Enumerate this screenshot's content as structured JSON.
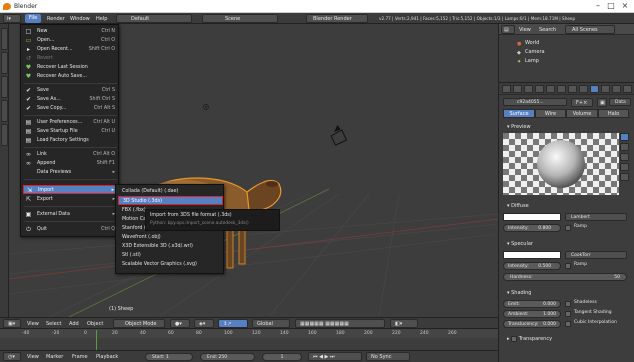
{
  "window": {
    "title": "Blender"
  },
  "topbar": {
    "menus": [
      "File",
      "Render",
      "Window",
      "Help"
    ],
    "screen_layout": "Default",
    "scene": "Scene",
    "render_engine": "Blender Render",
    "stats": "v2.77 | Verts:2,941 | Faces:5,152 | Tris:5,152 | Objects:1/3 | Lamps:0/1 | Mem:18.71M | Sheep"
  },
  "file_menu": {
    "items": [
      {
        "label": "New",
        "shortcut": "Ctrl N",
        "icon": "new-file-icon",
        "glyph": "□",
        "color": "#ddd"
      },
      {
        "label": "Open...",
        "shortcut": "Ctrl O",
        "icon": "open-folder-icon",
        "glyph": "▭",
        "color": "#d8b45a"
      },
      {
        "label": "Open Recent...",
        "shortcut": "Shift Ctrl O",
        "icon": "recent-icon",
        "glyph": "▸",
        "color": "#ddd"
      },
      {
        "label": "Revert",
        "shortcut": "",
        "icon": "revert-icon",
        "glyph": "↺",
        "color": "#777",
        "disabled": true
      },
      {
        "label": "Recover Last Session",
        "shortcut": "",
        "icon": "recover-icon",
        "glyph": "♥",
        "color": "#7fc36b"
      },
      {
        "label": "Recover Auto Save...",
        "shortcut": "",
        "icon": "recover-auto-icon",
        "glyph": "♥",
        "color": "#7fc36b"
      },
      {
        "label": "Save",
        "shortcut": "Ctrl S",
        "icon": "save-icon",
        "glyph": "✔",
        "color": "#ddd"
      },
      {
        "label": "Save As...",
        "shortcut": "Shift Ctrl S",
        "icon": "save-as-icon",
        "glyph": "✔",
        "color": "#ddd"
      },
      {
        "label": "Save Copy...",
        "shortcut": "Ctrl Alt S",
        "icon": "save-copy-icon",
        "glyph": "✔",
        "color": "#ddd"
      },
      {
        "label": "User Preferences...",
        "shortcut": "Ctrl Alt U",
        "icon": "preferences-icon",
        "glyph": "▤",
        "color": "#ddd"
      },
      {
        "label": "Save Startup File",
        "shortcut": "Ctrl U",
        "icon": "startup-icon",
        "glyph": "▤",
        "color": "#ddd"
      },
      {
        "label": "Load Factory Settings",
        "shortcut": "",
        "icon": "factory-icon",
        "glyph": "▤",
        "color": "#ddd"
      },
      {
        "label": "Link",
        "shortcut": "Ctrl Alt O",
        "icon": "link-icon",
        "glyph": "∞",
        "color": "#ddd"
      },
      {
        "label": "Append",
        "shortcut": "Shift F1",
        "icon": "append-icon",
        "glyph": "∞",
        "color": "#ddd"
      },
      {
        "label": "Data Previews",
        "shortcut": "▸",
        "icon": "",
        "glyph": "",
        "color": "#ddd"
      },
      {
        "label": "Import",
        "shortcut": "▸",
        "icon": "import-icon",
        "glyph": "⇲",
        "color": "#ddd",
        "highlight": true
      },
      {
        "label": "Export",
        "shortcut": "▸",
        "icon": "export-icon",
        "glyph": "⇱",
        "color": "#ddd"
      },
      {
        "label": "External Data",
        "shortcut": "▸",
        "icon": "external-icon",
        "glyph": "▣",
        "color": "#ddd"
      },
      {
        "label": "Quit",
        "shortcut": "Ctrl Q",
        "icon": "quit-icon",
        "glyph": "⏻",
        "color": "#ddd"
      }
    ]
  },
  "import_submenu": {
    "items": [
      {
        "label": "Collada (Default) (.dae)"
      },
      {
        "label": "3D Studio (.3ds)",
        "highlight": true
      },
      {
        "label": "FBX (.fbx)"
      },
      {
        "label": "Motion Capture (.bvh)"
      },
      {
        "label": "Stanford (.ply)"
      },
      {
        "label": "Wavefront (.obj)"
      },
      {
        "label": "X3D Extensible 3D (.x3d/.wrl)"
      },
      {
        "label": "Stl (.stl)"
      },
      {
        "label": "Scalable Vector Graphics (.svg)"
      }
    ]
  },
  "tooltip": {
    "title": "Import from 3DS file format (.3ds)",
    "python": "Python: bpy.ops.import_scene.autodesk_3ds()"
  },
  "viewport": {
    "object_label": "(1) Sheep"
  },
  "viewport_header": {
    "view": "View",
    "select": "Select",
    "add": "Add",
    "object": "Object",
    "mode": "Object Mode",
    "orientation": "Global"
  },
  "outliner": {
    "view": "View",
    "search": "Search",
    "scope": "All Scenes",
    "rows": [
      "World",
      "Camera",
      "Lamp"
    ]
  },
  "properties": {
    "material_name": "c92a4055...",
    "data_label": "Data",
    "tabs": [
      "Surface",
      "Wire",
      "Volume",
      "Halo"
    ],
    "preview_label": "Preview",
    "diffuse": {
      "label": "Diffuse",
      "shader": "Lambert",
      "intensity_label": "Intensity:",
      "intensity": "0.800",
      "ramp": "Ramp"
    },
    "specular": {
      "label": "Specular",
      "shader": "CookTorr",
      "intensity_label": "Intensity:",
      "intensity": "0.500",
      "ramp": "Ramp",
      "hardness_label": "Hardness:",
      "hardness": "50"
    },
    "shading": {
      "label": "Shading",
      "emit_label": "Emit:",
      "emit": "0.000",
      "ambient_label": "Ambient:",
      "ambient": "1.000",
      "translucency_label": "Translucency:",
      "translucency": "0.000",
      "shadeless": "Shadeless",
      "tangent": "Tangent Shading",
      "cubic": "Cubic Interpolation"
    },
    "transparency_label": "Transparency"
  },
  "timeline": {
    "ruler": [
      "-40",
      "-20",
      "0",
      "20",
      "40",
      "60",
      "80",
      "100",
      "120",
      "140",
      "160",
      "180",
      "200",
      "220",
      "240",
      "260"
    ],
    "view": "View",
    "marker": "Marker",
    "frame": "Frame",
    "playback": "Playback",
    "start_label": "Start:",
    "start": "1",
    "end_label": "End:",
    "end": "250",
    "current": "1",
    "sync": "No Sync"
  }
}
